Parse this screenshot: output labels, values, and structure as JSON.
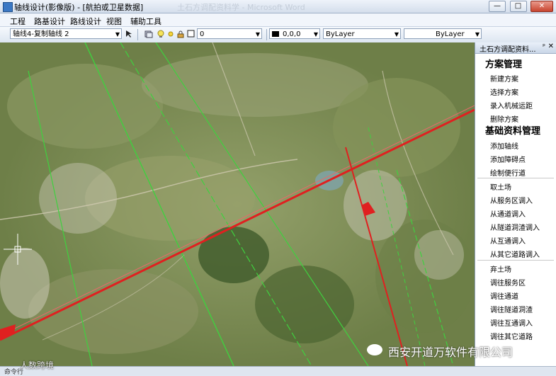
{
  "window": {
    "title": "轴线设计(影像版) - [航拍或卫星数据]",
    "ghost_title": "土石方调配资料学 - Microsoft Word",
    "minimize": "—",
    "maximize": "□",
    "close": "✕"
  },
  "menu": {
    "items": [
      "工程",
      "路基设计",
      "路线设计",
      "视图",
      "辅助工具"
    ]
  },
  "toolbar": {
    "axis_combo": "轴线4-复制轴线 2",
    "layer_combo": "0",
    "color_combo": "0,0,0",
    "linetype_combo": "ByLayer",
    "lineweight_combo": "ByLayer"
  },
  "panel": {
    "title": "土石方调配资料...",
    "pin": "ᵖ",
    "close": "✕",
    "section1": "方案管理",
    "section1_items": [
      "新建方案",
      "选择方案",
      "录入机械运距",
      "删除方案"
    ],
    "section2": "基础资料管理",
    "section2_items": [
      "添加轴线",
      "添加障碍点",
      "绘制便行道"
    ],
    "group3_items": [
      "取土场",
      "从服务区调入",
      "从通道调入",
      "从隧道洞渣调入",
      "从互通调入",
      "从其它道路调入"
    ],
    "group4_items": [
      "弃土场",
      "调往服务区",
      "调往通道",
      "调往隧道洞渣",
      "调往互通调入",
      "调往其它道路"
    ]
  },
  "status": {
    "cmd": "命令行"
  },
  "watermark": {
    "company": "西安开道万软件有限公司",
    "secondary": "人数跨境"
  },
  "colors": {
    "route_red": "#e02020",
    "guide_green": "#3fd13f",
    "terrain": "#7d8f55"
  }
}
